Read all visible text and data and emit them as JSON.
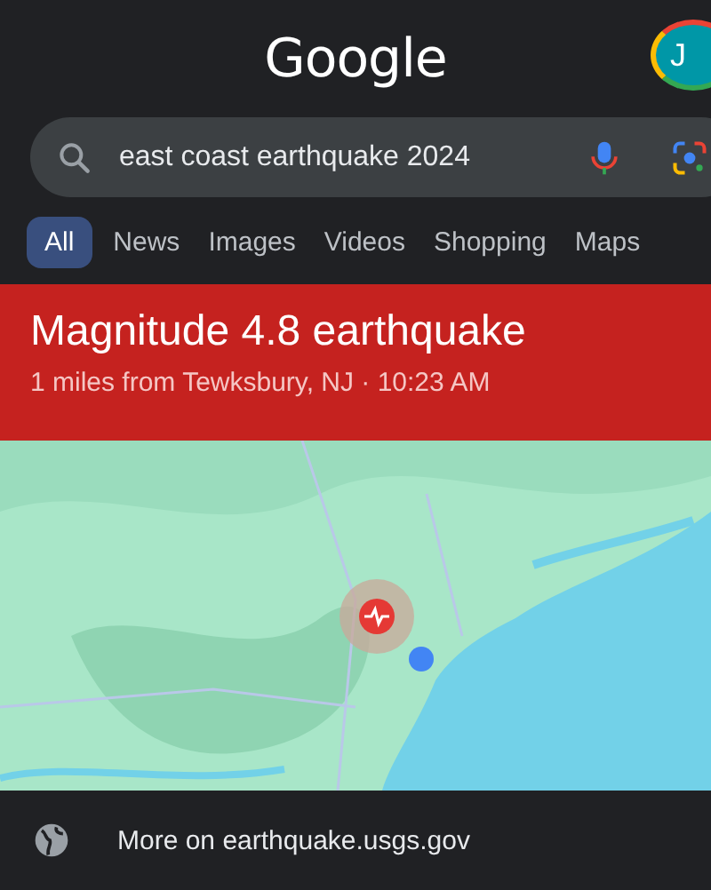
{
  "header": {
    "logo": "Google",
    "avatar_letter": "J"
  },
  "search": {
    "value": "east coast earthquake 2024"
  },
  "tabs": [
    {
      "label": "All",
      "selected": true
    },
    {
      "label": "News",
      "selected": false
    },
    {
      "label": "Images",
      "selected": false
    },
    {
      "label": "Videos",
      "selected": false
    },
    {
      "label": "Shopping",
      "selected": false
    },
    {
      "label": "Maps",
      "selected": false
    }
  ],
  "alert": {
    "title": "Magnitude 4.8 earthquake",
    "subtitle": "1 miles from Tewksbury, NJ · 10:23 AM"
  },
  "footer": {
    "link": "More on earthquake.usgs.gov"
  }
}
